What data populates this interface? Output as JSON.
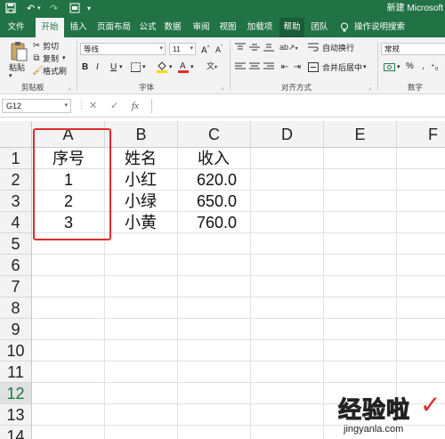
{
  "title_bar": {
    "document_title": "新建 Microsoft",
    "quick_access": {
      "save_icon": "save-icon",
      "undo_icon": "undo-icon",
      "redo_icon": "redo-icon",
      "customize_icon": "customize-icon"
    }
  },
  "ribbon_tabs": [
    {
      "label": "文件"
    },
    {
      "label": "开始"
    },
    {
      "label": "插入"
    },
    {
      "label": "页面布局"
    },
    {
      "label": "公式"
    },
    {
      "label": "数据"
    },
    {
      "label": "审阅"
    },
    {
      "label": "视图"
    },
    {
      "label": "加载项"
    },
    {
      "label": "帮助"
    },
    {
      "label": "团队"
    },
    {
      "label": "操作说明搜索"
    }
  ],
  "ribbon": {
    "clipboard": {
      "paste_label": "粘贴",
      "cut_label": "剪切",
      "copy_label": "复制",
      "format_painter_label": "格式刷",
      "group_label": "剪贴板"
    },
    "font": {
      "font_name": "等线",
      "font_size": "11",
      "group_label": "字体"
    },
    "alignment": {
      "wrap_text_label": "自动换行",
      "merge_center_label": "合并后居中",
      "group_label": "对齐方式"
    },
    "number": {
      "format_value": "常规",
      "group_label": "数字"
    }
  },
  "formula_bar": {
    "name_box_value": "G12",
    "cancel_symbol": "✕",
    "enter_symbol": "✓",
    "fx_symbol": "fx",
    "formula_value": ""
  },
  "sheet": {
    "columns": [
      "A",
      "B",
      "C",
      "D",
      "E",
      "F"
    ],
    "rows": [
      "1",
      "2",
      "3",
      "4",
      "5",
      "6",
      "7",
      "8",
      "9",
      "10",
      "11",
      "12",
      "13",
      "14"
    ],
    "selected_row": "12",
    "cells": {
      "A1": "序号",
      "B1": "姓名",
      "C1": "收入",
      "A2": "1",
      "B2": "小红",
      "C2": "620.0",
      "A3": "2",
      "B3": "小绿",
      "C3": "650.0",
      "A4": "3",
      "B4": "小黄",
      "C4": "760.0"
    }
  },
  "watermark": {
    "main_text": "经验啦",
    "sub_text": "jingyanla.com",
    "check_symbol": "✓"
  },
  "colors": {
    "excel_green": "#217346",
    "highlight_red": "#e02b2b"
  }
}
